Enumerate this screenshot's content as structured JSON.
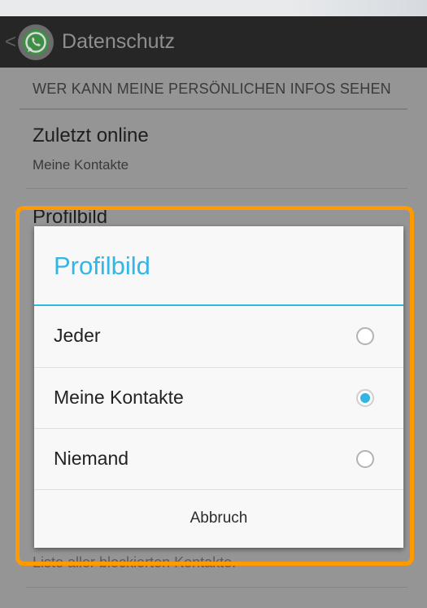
{
  "actionbar": {
    "title": "Datenschutz",
    "back_icon": "<",
    "logo_icon": "whatsapp-logo-icon"
  },
  "settings": {
    "section_header": "WER KANN MEINE PERSÖNLICHEN INFOS SEHEN",
    "items": [
      {
        "title": "Zuletzt online",
        "subtitle": "Meine Kontakte"
      },
      {
        "title": "Profilbild"
      }
    ],
    "obscured_text": "Liste aller blockierten Kontakte."
  },
  "dialog": {
    "title": "Profilbild",
    "options": [
      {
        "label": "Jeder",
        "selected": false
      },
      {
        "label": "Meine Kontakte",
        "selected": true
      },
      {
        "label": "Niemand",
        "selected": false
      }
    ],
    "cancel_label": "Abbruch"
  },
  "colors": {
    "accent": "#33b5e5",
    "highlight": "#ff9a00",
    "actionbar": "#262626"
  }
}
